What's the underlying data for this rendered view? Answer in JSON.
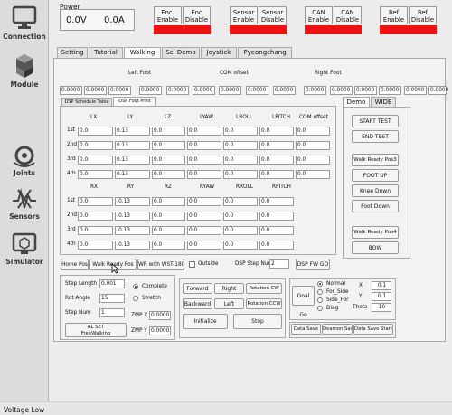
{
  "sidebar": {
    "items": [
      {
        "label": "Connection",
        "icon": "monitor-icon"
      },
      {
        "label": "Module",
        "icon": "cubes-icon"
      },
      {
        "label": "Joints",
        "icon": "joints-icon"
      },
      {
        "label": "Sensors",
        "icon": "sensors-icon"
      },
      {
        "label": "Simulator",
        "icon": "simulator-icon"
      }
    ]
  },
  "power": {
    "title": "Power",
    "voltage": "0.0V",
    "current": "0.0A"
  },
  "toggles": [
    {
      "enable": "Enc.\nEnable",
      "disable": "Enc\nDisable",
      "enable_lbl": "Enc. Enable",
      "disable_lbl": "Enc Disable"
    },
    {
      "enable_lbl": "Sensor Enable",
      "disable_lbl": "Sensor Disable"
    },
    {
      "enable_lbl": "CAN Enable",
      "disable_lbl": "CAN Disable"
    },
    {
      "enable_lbl": "Ref Enable",
      "disable_lbl": "Ref Disable"
    }
  ],
  "tabs": [
    "Setting",
    "Tutorial",
    "Walking",
    "Sci Demo",
    "Joystick",
    "Pyeongchang"
  ],
  "top_labels": {
    "left_foot": "Left Foot",
    "com_offset": "COM offset",
    "right_foot": "Right Foot"
  },
  "top_fields": [
    "0.0000",
    "0.0000",
    "0.0000",
    "0.0000",
    "0.0000",
    "0.0000",
    "0.0000",
    "0.0000",
    "0.0000",
    "0.0000",
    "0.0000",
    "0.0000",
    "0.0000",
    "0.0000",
    "0.0000"
  ],
  "dsp_tabs": [
    "DSP Schedule Table",
    "DSP Foot Print"
  ],
  "left_headers": [
    "LX",
    "LY",
    "LZ",
    "LYAW",
    "LROLL",
    "LPITCH",
    "COM offset"
  ],
  "right_headers": [
    "RX",
    "RY",
    "RZ",
    "RYAW",
    "RROLL",
    "RPITCH"
  ],
  "row_labels": [
    "1st",
    "2nd",
    "3rd",
    "4th"
  ],
  "left_rows": [
    [
      "0.0",
      "0.13",
      "0.0",
      "0.0",
      "0.0",
      "0.0",
      "0.0"
    ],
    [
      "0.0",
      "0.13",
      "0.0",
      "0.0",
      "0.0",
      "0.0",
      "0.0"
    ],
    [
      "0.0",
      "0.13",
      "0.0",
      "0.0",
      "0.0",
      "0.0",
      "0.0"
    ],
    [
      "0.0",
      "0.13",
      "0.0",
      "0.0",
      "0.0",
      "0.0",
      "0.0"
    ]
  ],
  "right_rows": [
    [
      "0.0",
      "-0.13",
      "0.0",
      "0.0",
      "0.0",
      "0.0"
    ],
    [
      "0.0",
      "-0.13",
      "0.0",
      "0.0",
      "0.0",
      "0.0"
    ],
    [
      "0.0",
      "-0.13",
      "0.0",
      "0.0",
      "0.0",
      "0.0"
    ],
    [
      "0.0",
      "-0.13",
      "0.0",
      "0.0",
      "0.0",
      "0.0"
    ]
  ],
  "demo_tabs": [
    "Demo",
    "WIDE"
  ],
  "demo_buttons": [
    "START TEST",
    "END TEST",
    "Walk Ready Pos3",
    "FOOT UP",
    "Knee Down",
    "Foot Down",
    "Walk Ready Pos4",
    "BOW"
  ],
  "bottom_row": {
    "home": "Home Pos",
    "walk_ready": "Walk Ready Pos",
    "wr_wst": "WR with WST-180",
    "outside": "Outside",
    "step_num_label": "DSP Step Num",
    "step_num": "2",
    "dsp_fw_go": "DSP FW GO"
  },
  "walk": {
    "step_length_label": "Step Length",
    "step_length": "0.001",
    "rot_angle_label": "Rot Angle",
    "rot_angle": "15",
    "step_num_label": "Step Num",
    "step_num": "1",
    "al_set": "AL SET\nFreeWalking",
    "complete": "Complete",
    "stretch": "Stretch",
    "zmp_x_label": "ZMP X",
    "zmp_x": "0.0000",
    "zmp_y_label": "ZMP Y",
    "zmp_y": "0.0000"
  },
  "move_buttons": [
    "Forward",
    "Right",
    "Rotation CW",
    "Backward",
    "Left",
    "Rotation CCW",
    "Initialize",
    "Stop"
  ],
  "goal": {
    "button": "Goal Go",
    "options": [
      "Normal",
      "For_Side",
      "Side_For",
      "Diag"
    ],
    "x_label": "X",
    "x": "0.1",
    "y_label": "Y",
    "y": "0.1",
    "theta_label": "Theta",
    "theta": "10"
  },
  "data_buttons": [
    "Data Save",
    "Deamon Save",
    "Data Save Start"
  ],
  "status": "Voltage Low",
  "colors": {
    "red": "#ee1111"
  }
}
